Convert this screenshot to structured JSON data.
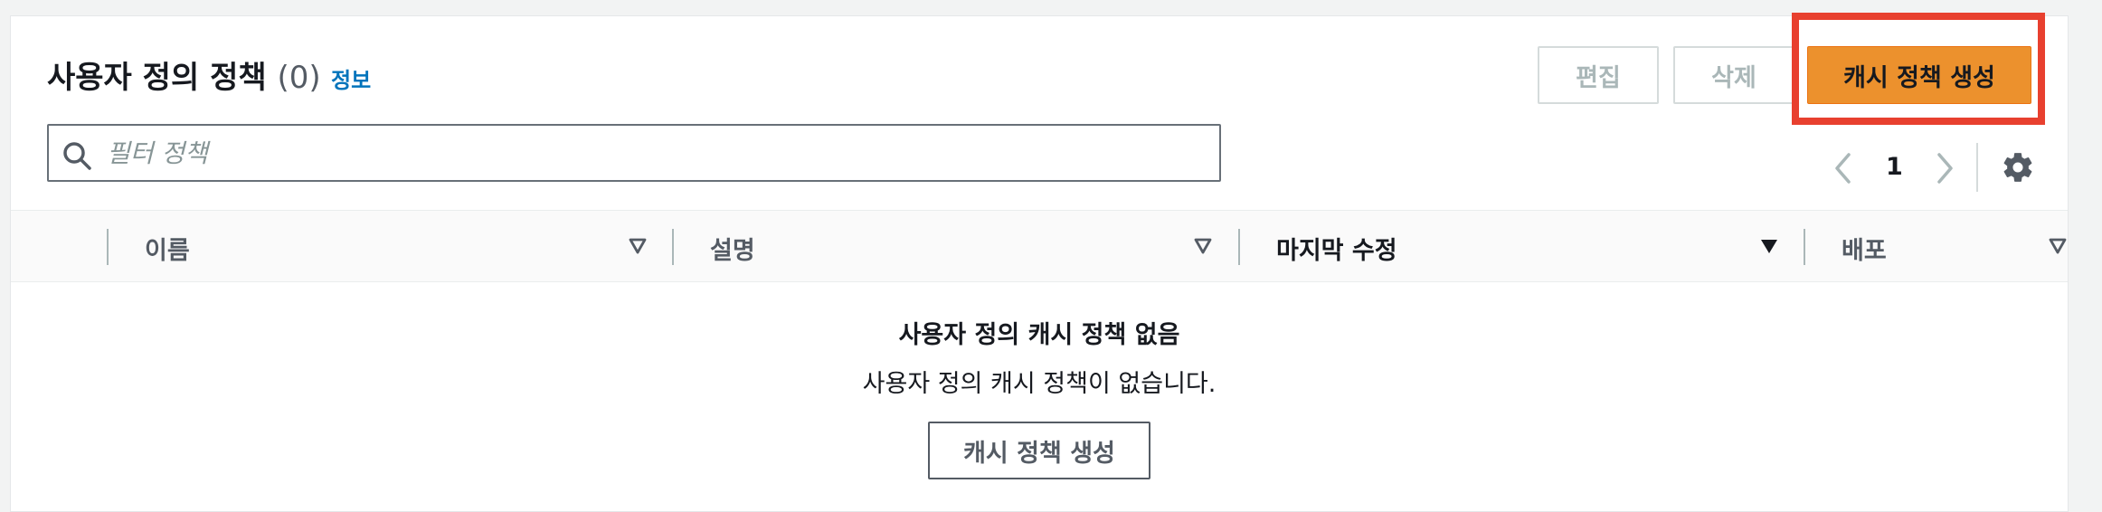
{
  "header": {
    "title": "사용자 정의 정책",
    "count": "(0)",
    "info_link": "정보",
    "edit_button": "편집",
    "delete_button": "삭제",
    "create_button": "캐시 정책 생성"
  },
  "search": {
    "placeholder": "필터 정책",
    "value": ""
  },
  "pagination": {
    "current_page": "1"
  },
  "table": {
    "columns": [
      {
        "label": "이름",
        "sort": "unsorted"
      },
      {
        "label": "설명",
        "sort": "unsorted"
      },
      {
        "label": "마지막 수정",
        "sort": "sorted-descending"
      },
      {
        "label": "배포",
        "sort": "unsorted"
      }
    ]
  },
  "empty_state": {
    "title": "사용자 정의 캐시 정책 없음",
    "description": "사용자 정의 캐시 정책이 없습니다.",
    "button": "캐시 정책 생성"
  },
  "colors": {
    "primary": "#ec912d",
    "link": "#0073bb",
    "highlight": "#e8402f",
    "text": "#16191f"
  }
}
